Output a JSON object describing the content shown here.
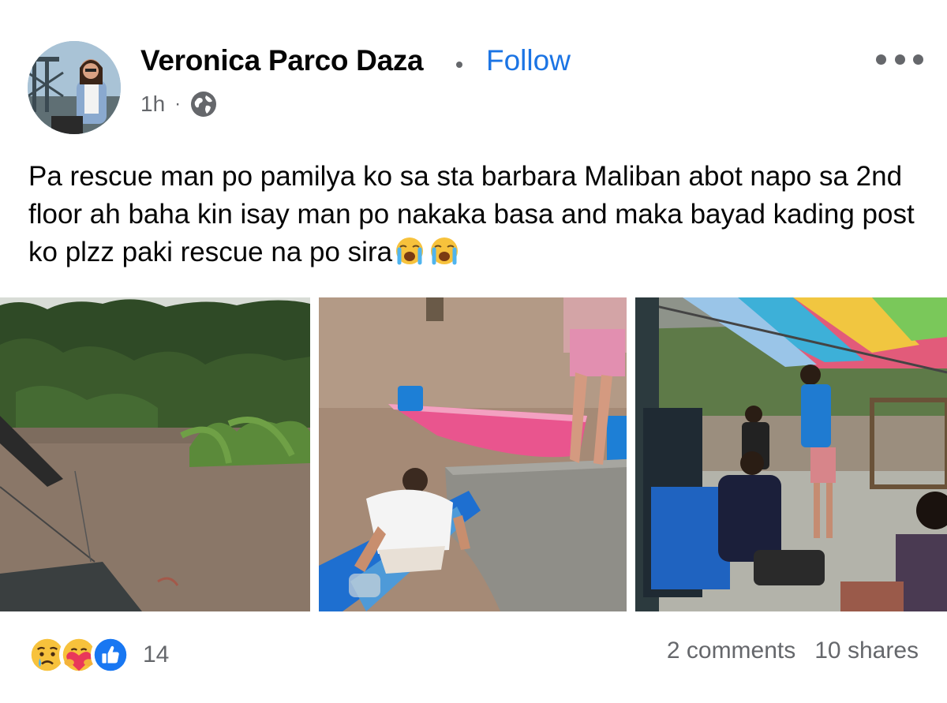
{
  "post": {
    "author": "Veronica Parco Daza",
    "follow_label": "Follow",
    "time": "1h",
    "separator": "·",
    "audience_icon": "globe-icon",
    "more_icon": "more-options-icon",
    "text": "Pa rescue man po pamilya ko sa sta barbara Maliban abot napo sa 2nd floor ah baha kin isay man po nakaka basa and maka bayad kading post ko plzz paki rescue na po sira",
    "text_emojis": [
      "crying-face-emoji",
      "crying-face-emoji"
    ],
    "photos": [
      {
        "icon": "flooded-trees-photo"
      },
      {
        "icon": "pink-boat-flood-photo"
      },
      {
        "icon": "family-under-tarp-photo"
      }
    ]
  },
  "footer": {
    "reactions": [
      "sad-reaction-icon",
      "care-reaction-icon",
      "like-reaction-icon"
    ],
    "reaction_count": "14",
    "comments": "2 comments",
    "shares": "10 shares"
  },
  "colors": {
    "link": "#1b74e4",
    "secondary_text": "#65676b",
    "primary_text": "#050505",
    "like_blue": "#1877f2"
  }
}
